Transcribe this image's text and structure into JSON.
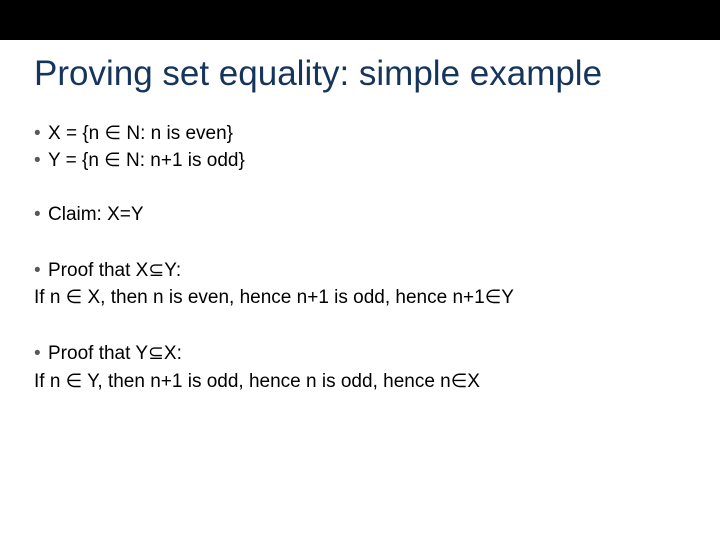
{
  "title": "Proving set equality: simple example",
  "bullets": {
    "b1": "X = {n ∈ N: n is even}",
    "b2": "Y = {n ∈ N: n+1 is odd}",
    "b3": "Claim: X=Y",
    "b4": "Proof that X⊆Y:",
    "b4line": "If n ∈ X, then n is even, hence n+1 is odd, hence n+1∈Y",
    "b5": "Proof that Y⊆X:",
    "b5line": "If n ∈ Y, then n+1 is odd, hence n is odd, hence n∈X"
  },
  "glyphs": {
    "bullet": "•"
  }
}
